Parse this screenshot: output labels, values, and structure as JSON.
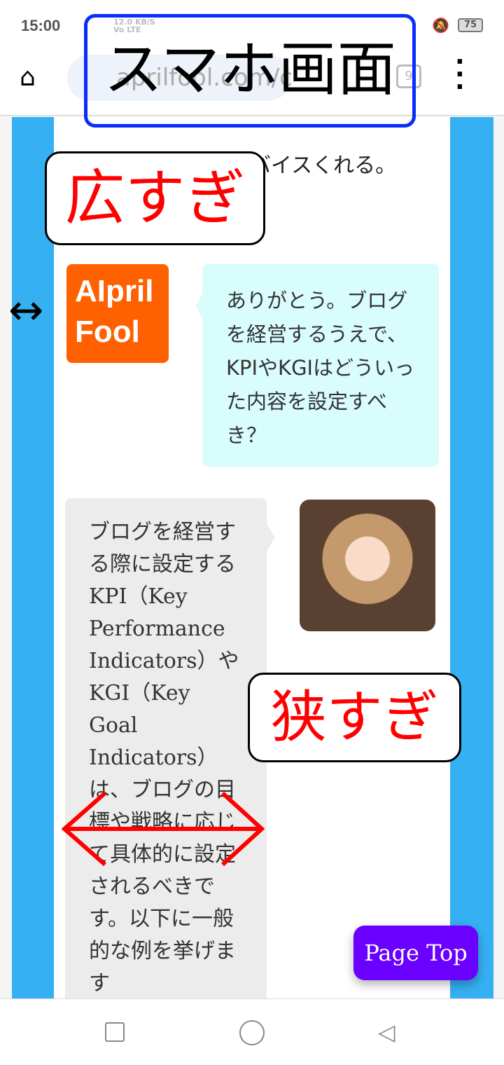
{
  "status": {
    "time": "15:00",
    "net_speed": "12.0 KB/S",
    "net_type": "Vo LTE",
    "battery": "75"
  },
  "browser": {
    "url": "aprilfool.com/c",
    "tab_count": "9"
  },
  "annotations": {
    "title": "スマホ画面",
    "too_wide": "広すぎ",
    "too_narrow": "狭すぎ",
    "accent_box": "#0a2cff",
    "accent_text": "#ff0000"
  },
  "chat": {
    "prev_text": "相手に合ったアドバイスくれる。",
    "user_avatar": "AIpril Fool",
    "user_message": "ありがとう。ブログを経営するうえで、KPIやKGIはどういった内容を設定すべき？",
    "ai_message": "ブログを経営する際に設定するKPI（Key Performance Indicators）やKGI（Key Goal Indicators）は、ブログの目標や戦略に応じて具体的に設定されるべきです。以下に一般的な例を挙げます"
  },
  "page_top": "Page Top",
  "colors": {
    "sidebar": "#35b0f2",
    "user_avatar": "#ff6000",
    "user_bubble": "#d9fcfc",
    "ai_bubble": "#ececec",
    "page_top": "#6a00ff"
  }
}
